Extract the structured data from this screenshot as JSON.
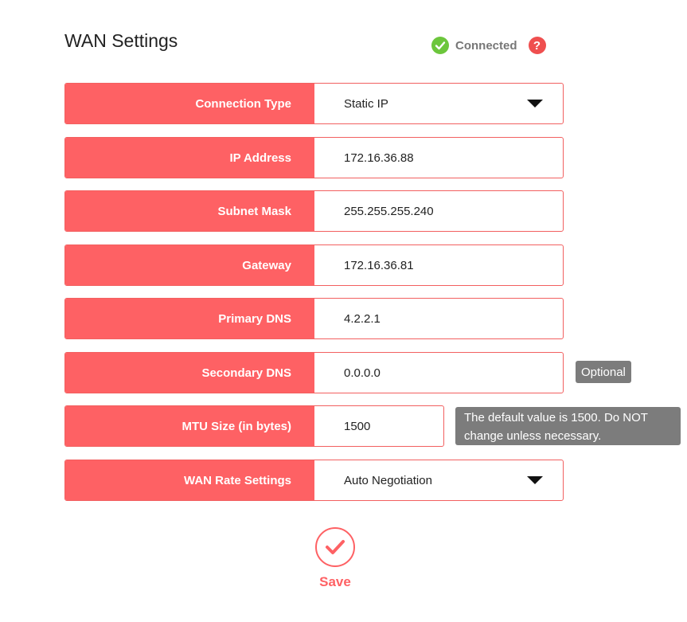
{
  "page": {
    "title": "WAN Settings",
    "status": {
      "text": "Connected",
      "icon": "check-circle-icon",
      "color": "#6cc63c"
    },
    "help_icon": "?"
  },
  "fields": {
    "connection_type": {
      "label": "Connection Type",
      "value": "Static IP"
    },
    "ip_address": {
      "label": "IP Address",
      "value": "172.16.36.88"
    },
    "subnet_mask": {
      "label": "Subnet Mask",
      "value": "255.255.255.240"
    },
    "gateway": {
      "label": "Gateway",
      "value": "172.16.36.81"
    },
    "primary_dns": {
      "label": "Primary DNS",
      "value": "4.2.2.1"
    },
    "secondary_dns": {
      "label": "Secondary DNS",
      "value": "0.0.0.0",
      "hint": "Optional"
    },
    "mtu_size": {
      "label": "MTU Size (in bytes)",
      "value": "1500",
      "hint": "The default value is 1500. Do NOT change unless necessary."
    },
    "wan_rate": {
      "label": "WAN Rate Settings",
      "value": "Auto Negotiation"
    }
  },
  "actions": {
    "save_label": "Save"
  },
  "colors": {
    "accent": "#fe6164",
    "tooltip": "#7c7c7c"
  }
}
